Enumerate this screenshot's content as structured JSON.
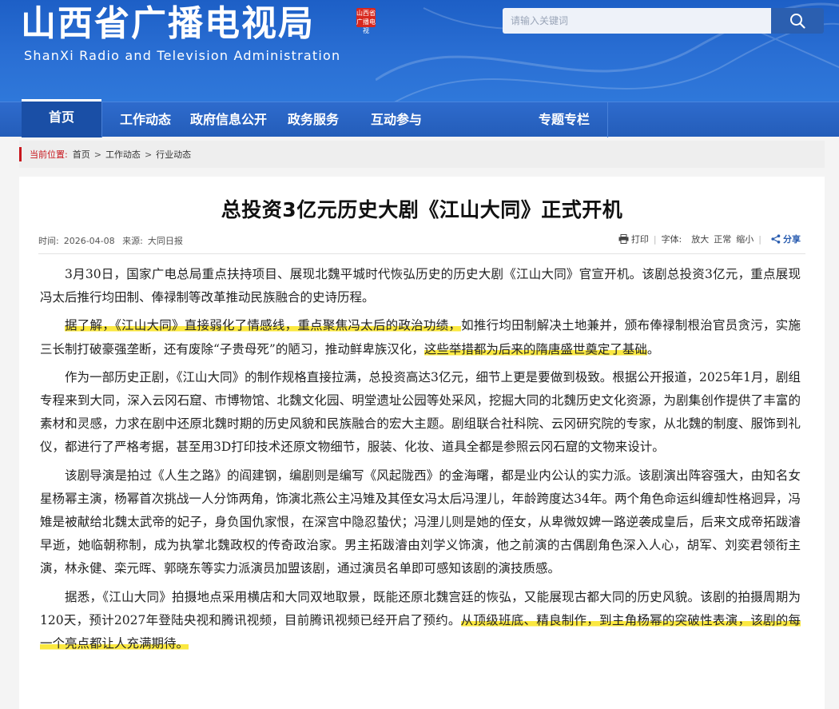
{
  "header": {
    "logo_cn": "山西省广播电视局",
    "seal_text": "山西省广播电视",
    "logo_en": "ShanXi Radio and Television Administration",
    "search_placeholder": "请输入关键词",
    "colors": {
      "header_blue": "#2a6fd4",
      "nav_blue": "#245db9",
      "accent_red": "#c8161d",
      "highlight": "#fbe840"
    }
  },
  "nav": {
    "items": [
      {
        "label": "首页",
        "active": true
      },
      {
        "label": "工作动态"
      },
      {
        "label": "政府信息公开"
      },
      {
        "label": "政务服务"
      },
      {
        "label": "互动参与"
      },
      {
        "label": "专题专栏"
      }
    ]
  },
  "breadcrumb": {
    "label": "当前位置:",
    "items": [
      "首页",
      "工作动态",
      "行业动态"
    ],
    "sep": ">"
  },
  "article": {
    "title": "总投资3亿元历史大剧《江山大同》正式开机",
    "time_label": "时间:",
    "time": "2026-04-08",
    "source_label": "来源:",
    "source": "大同日报",
    "print": "打印",
    "font_label": "字体:",
    "font_large": "放大",
    "font_normal": "正常",
    "font_small": "缩小",
    "share": "分享",
    "p1": "3月30日，国家广电总局重点扶持项目、展现北魏平城时代恢弘历史的历史大剧《江山大同》官宣开机。该剧总投资3亿元，重点展现冯太后推行均田制、俸禄制等改革推动民族融合的史诗历程。",
    "p2_hl1": "据了解，《江山大同》直接弱化了情感线，重点聚焦冯太后的政治功绩，",
    "p2_mid": "如推行均田制解决土地兼并，颁布俸禄制根治官员贪污，实施三长制打破豪强垄断，还有废除“子贵母死”的陋习，推动鲜卑族汉化，",
    "p2_hl2": "这些举措都为后来的隋唐盛世奠定了基础",
    "p2_end": "。",
    "p3": "作为一部历史正剧，《江山大同》的制作规格直接拉满，总投资高达3亿元，细节上更是要做到极致。根据公开报道，2025年1月，剧组专程来到大同，深入云冈石窟、市博物馆、北魏文化园、明堂遗址公园等处采风，挖掘大同的北魏历史文化资源，为剧集创作提供了丰富的素材和灵感，力求在剧中还原北魏时期的历史风貌和民族融合的宏大主题。剧组联合社科院、云冈研究院的专家，从北魏的制度、服饰到礼仪，都进行了严格考据，甚至用3D打印技术还原文物细节，服装、化妆、道具全都是参照云冈石窟的文物来设计。",
    "p4": "该剧导演是拍过《人生之路》的阎建钢，编剧则是编写《风起陇西》的金海曙，都是业内公认的实力派。该剧演出阵容强大，由知名女星杨幂主演，杨幂首次挑战一人分饰两角，饰演北燕公主冯雉及其侄女冯太后冯浬儿，年龄跨度达34年。两个角色命运纠缠却性格迥异，冯雉是被献给北魏太武帝的妃子，身负国仇家恨，在深宫中隐忍蛰伏；冯浬儿则是她的侄女，从卑微奴婢一路逆袭成皇后，后来文成帝拓跋濬早逝，她临朝称制，成为执掌北魏政权的传奇政治家。男主拓跋濬由刘学义饰演，他之前演的古偶剧角色深入人心，胡军、刘奕君领衔主演，林永健、栾元晖、郭晓东等实力派演员加盟该剧，通过演员名单即可感知该剧的演技质感。",
    "p5_start": "据悉，《江山大同》拍摄地点采用横店和大同双地取景，既能还原北魏宫廷的恢弘，又能展现古都大同的历史风貌。该剧的拍摄周期为120天，预计2027年登陆央视和腾讯视频，目前腾讯视频已经开启了预约。",
    "p5_hl": "从顶级班底、精良制作，到主角杨幂的突破性表演，该剧的每一个亮点都让人充满期待。"
  }
}
